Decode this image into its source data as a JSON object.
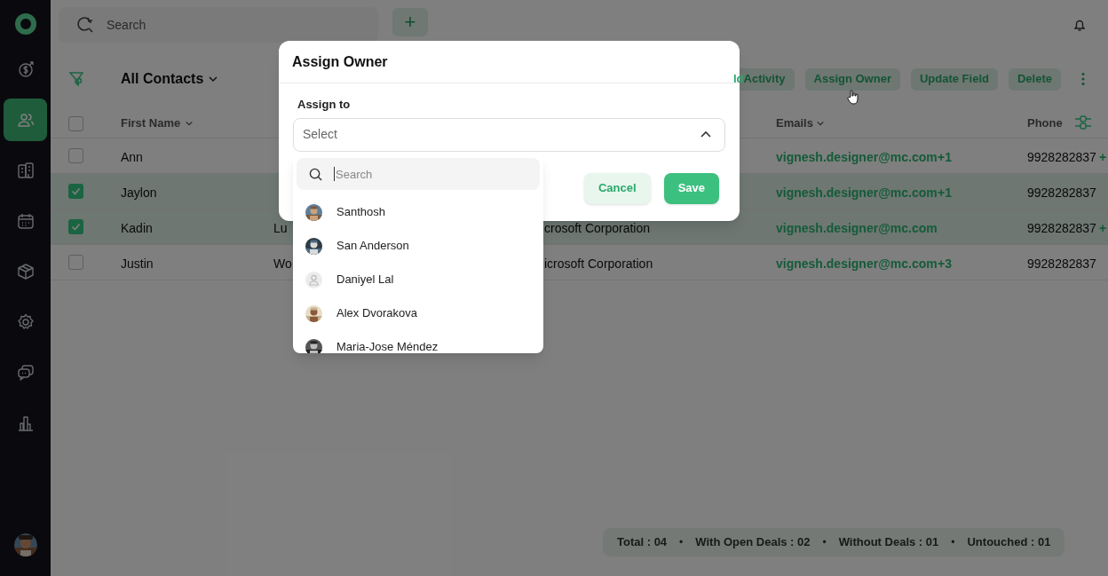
{
  "sidebar": {
    "items": [
      {
        "kind": "deals",
        "selected": false
      },
      {
        "kind": "contacts",
        "selected": true
      },
      {
        "kind": "companies",
        "selected": false
      },
      {
        "kind": "calendar",
        "selected": false
      },
      {
        "kind": "products",
        "selected": false
      },
      {
        "kind": "settings",
        "selected": false
      },
      {
        "kind": "chat",
        "selected": false
      },
      {
        "kind": "reports",
        "selected": false
      }
    ]
  },
  "topbar": {
    "search_placeholder": "Search",
    "add_label": "+"
  },
  "view": {
    "title": "All Contacts"
  },
  "toolbar": {
    "fragment": "ld",
    "buttons": [
      "Activity",
      "Assign Owner",
      "Update Field",
      "Delete"
    ]
  },
  "table": {
    "select_all_checked": false,
    "columns": [
      "First Name",
      "Emails",
      "Phone"
    ],
    "rows": [
      {
        "checked": false,
        "first_name": "Ann",
        "email": "vignesh.designer@mc.com",
        "email_extra": "+1",
        "phone": "9928282837",
        "phone_extra": "+"
      },
      {
        "checked": true,
        "first_name": "Jaylon",
        "email": "vignesh.designer@mc.com",
        "email_extra": "+1",
        "phone": "9928282837"
      },
      {
        "checked": true,
        "first_name": "Kadin",
        "column_2": "Lu",
        "column_3": "crosoft Corporation",
        "email": "vignesh.designer@mc.com",
        "phone": "9928282837",
        "phone_extra": "+"
      },
      {
        "checked": false,
        "first_name": "Justin",
        "column_2": "Wo",
        "column_3": "icrosoft Corporation",
        "email": "vignesh.designer@mc.com",
        "email_extra": "+3",
        "phone": "9928282837"
      }
    ]
  },
  "summary": {
    "items": [
      "Total : 04",
      "With Open Deals : 02",
      "Without Deals : 01",
      "Untouched : 01"
    ],
    "separators": [
      "•",
      "•",
      "•"
    ]
  },
  "modal": {
    "title": "Assign Owner",
    "label": "Assign to",
    "select_placeholder": "Select",
    "expanded": true,
    "search_placeholder": "Search",
    "options": [
      {
        "name": "Santhosh"
      },
      {
        "name": "San Anderson"
      },
      {
        "name": "Daniyel Lal",
        "kind": "generic"
      },
      {
        "name": "Alex Dvorakova"
      },
      {
        "name": "Maria-Jose Méndez"
      }
    ],
    "buttons": [
      "Cancel",
      "Save"
    ]
  }
}
